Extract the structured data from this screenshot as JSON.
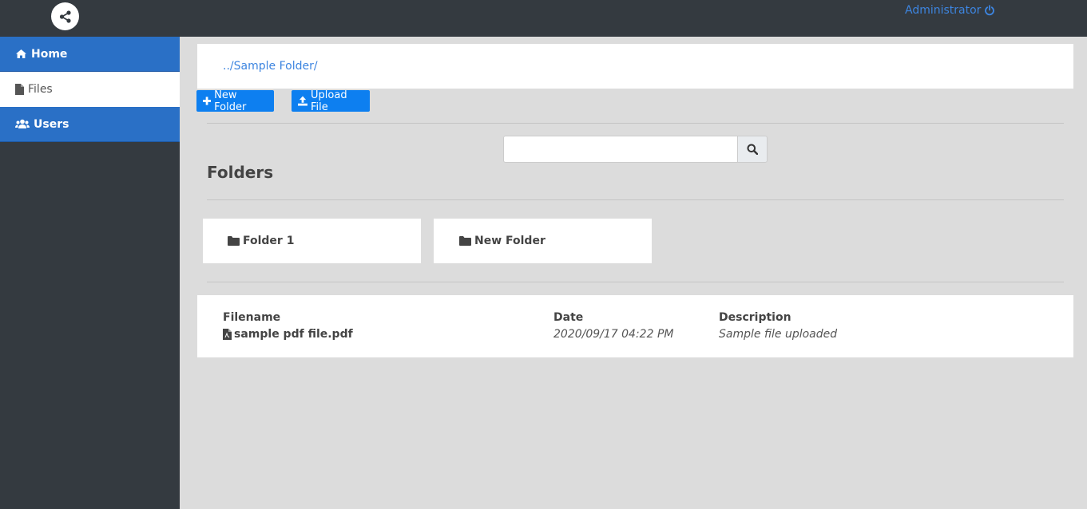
{
  "header": {
    "logo_icon": "share-icon",
    "user_label": "Administrator",
    "logout_icon": "power-icon"
  },
  "sidebar": {
    "items": [
      {
        "label": "Home",
        "icon": "home-icon"
      },
      {
        "label": "Files",
        "icon": "file-icon"
      },
      {
        "label": "Users",
        "icon": "users-icon"
      }
    ]
  },
  "breadcrumb": {
    "prefix": "../",
    "folder": "Sample Folder",
    "suffix": "/"
  },
  "toolbar": {
    "new_folder_label": "New Folder",
    "upload_label": "Upload File"
  },
  "search": {
    "value": "",
    "placeholder": ""
  },
  "folders": {
    "title": "Folders",
    "items": [
      {
        "name": "Folder 1"
      },
      {
        "name": "New Folder"
      }
    ]
  },
  "files": {
    "columns": [
      "Filename",
      "Date",
      "Description"
    ],
    "rows": [
      {
        "filename": "sample pdf file.pdf",
        "date": "2020/09/17 04:22 PM",
        "description": "Sample file uploaded"
      }
    ]
  },
  "colors": {
    "accent": "#0d7ff0",
    "sidebar_active": "#2a70c6",
    "dark": "#343a40"
  }
}
